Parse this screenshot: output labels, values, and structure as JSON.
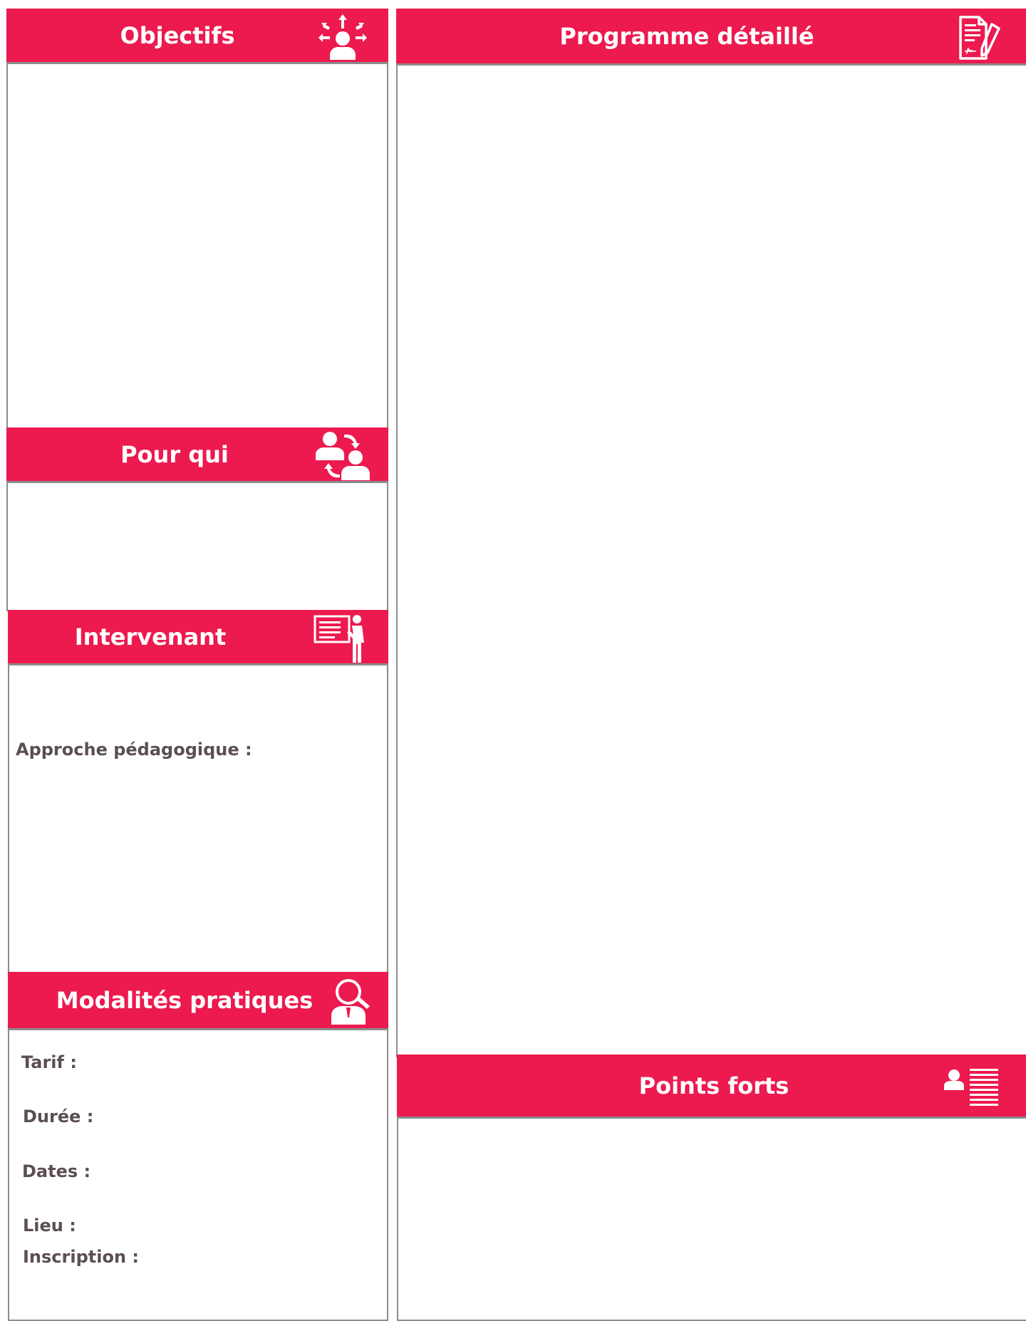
{
  "colors": {
    "accent": "#ec1a4f",
    "border": "#8c8c8c",
    "label_text": "#5b4e54"
  },
  "objectifs": {
    "title": "Objectifs",
    "icon": "person-radiating-arrows-icon"
  },
  "programme": {
    "title": "Programme détaillé",
    "icon": "document-pen-icon"
  },
  "pour_qui": {
    "title": "Pour qui",
    "icon": "people-exchange-icon"
  },
  "intervenant": {
    "title": "Intervenant",
    "icon": "presenter-board-icon",
    "approche_label": "Approche pédagogique :"
  },
  "modalites": {
    "title": "Modalités pratiques",
    "icon": "person-magnifier-icon",
    "fields": {
      "tarif": "Tarif :",
      "duree": "Durée :",
      "dates": "Dates :",
      "lieu": "Lieu :",
      "inscription": "Inscription :"
    }
  },
  "points_forts": {
    "title": "Points forts",
    "icon": "person-list-icon"
  }
}
